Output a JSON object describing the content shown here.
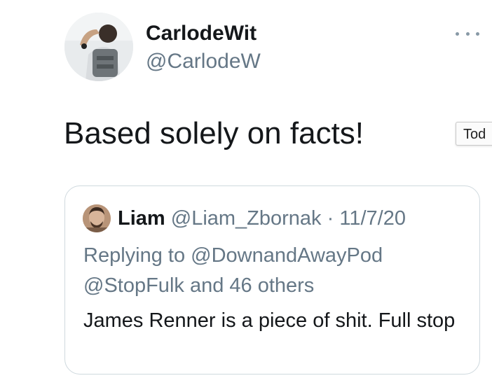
{
  "tweet": {
    "author": {
      "display_name": "CarlodeWit",
      "handle": "@CarlodeW",
      "avatar_icon": "profile-photo"
    },
    "more_icon": "more-horizontal-icon",
    "text": "Based solely on facts!"
  },
  "tooltip": {
    "text": "Tod"
  },
  "quoted_tweet": {
    "author": {
      "display_name": "Liam",
      "handle": "@Liam_Zbornak",
      "avatar_icon": "profile-photo"
    },
    "separator": " · ",
    "date": "11/7/20",
    "replying_to_prefix": "Replying to ",
    "replying_to_user": "@DownandAwayPod",
    "replying_to_rest": "@StopFulk and 46 others",
    "text": "James Renner is a piece of shit. Full stop"
  },
  "colors": {
    "primary_text": "#14171a",
    "secondary_text": "#657786",
    "border": "#cfd9de"
  }
}
